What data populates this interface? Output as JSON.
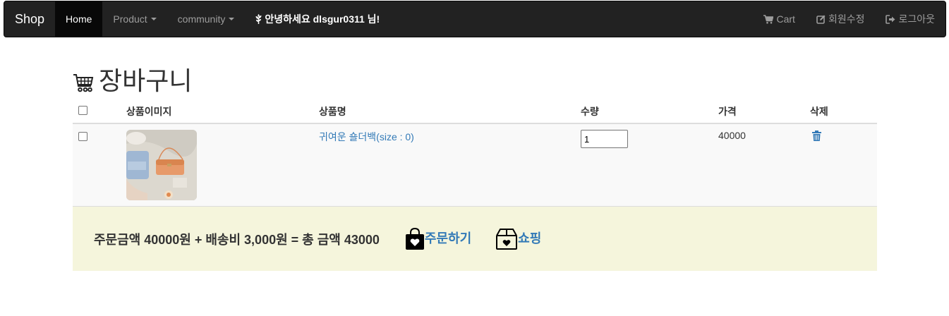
{
  "nav": {
    "brand": "Shop",
    "items": [
      {
        "label": "Home",
        "active": true
      },
      {
        "label": "Product",
        "dropdown": true
      },
      {
        "label": "community",
        "dropdown": true
      }
    ],
    "greeting": "안녕하세요 dlsgur0311 님!",
    "right": [
      {
        "label": "Cart",
        "icon": "cart-icon"
      },
      {
        "label": "회원수정",
        "icon": "edit-icon"
      },
      {
        "label": "로그아웃",
        "icon": "logout-icon"
      }
    ]
  },
  "page": {
    "title": "장바구니"
  },
  "table": {
    "headers": [
      "상품이미지",
      "상품명",
      "수량",
      "가격",
      "삭제"
    ],
    "rows": [
      {
        "name": "귀여운 숄더백(size : 0)",
        "qty": "1",
        "price": "40000"
      }
    ]
  },
  "summary": {
    "text": "주문금액 40000원 + 배송비 3,000원 = 총 금액 43000",
    "order_label": "주문하기",
    "shopping_label": "쇼핑"
  },
  "colors": {
    "navbar": "#222222",
    "link": "#337ab7",
    "summary_bg": "#f5f5dc"
  }
}
